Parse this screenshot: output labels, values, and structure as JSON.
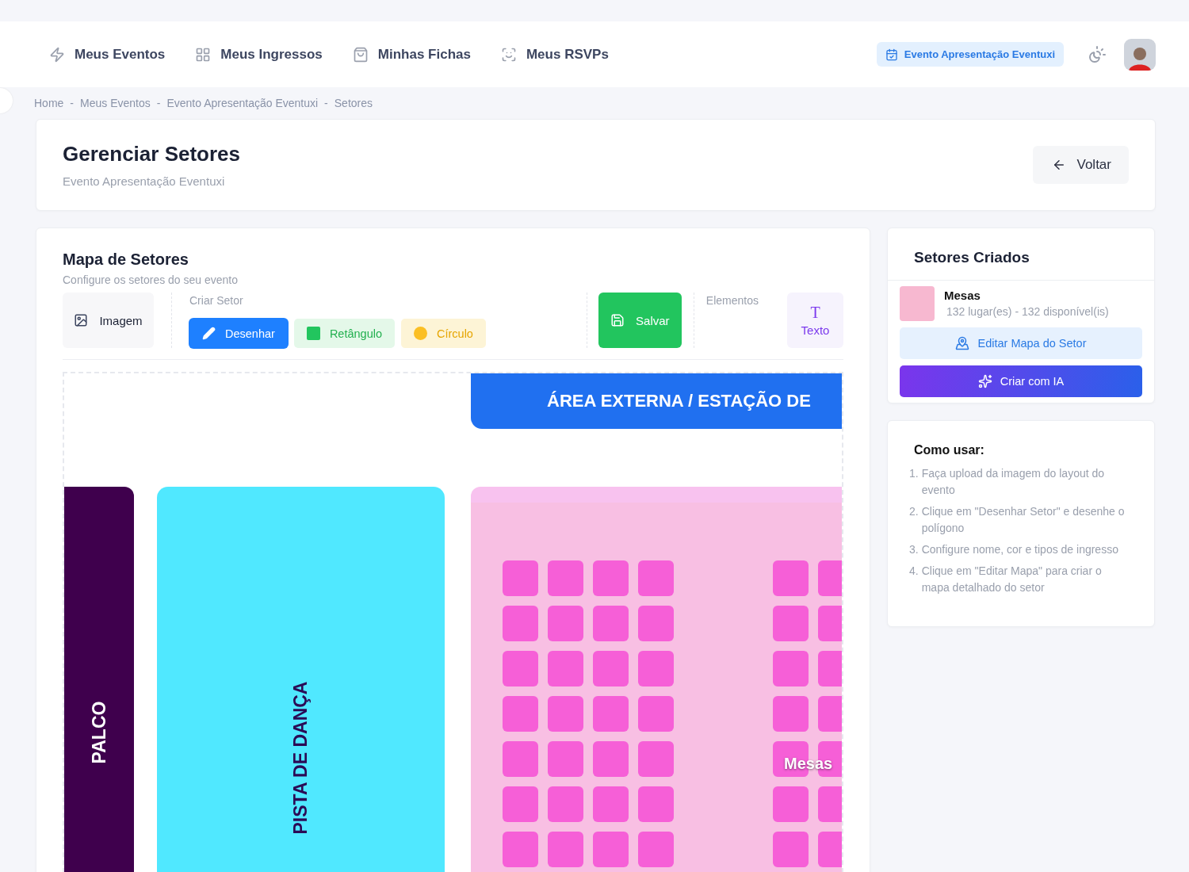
{
  "nav": {
    "items": [
      {
        "label": "Meus Eventos"
      },
      {
        "label": "Meus Ingressos"
      },
      {
        "label": "Minhas Fichas"
      },
      {
        "label": "Meus RSVPs"
      }
    ],
    "event_badge": "Evento Apresentação Eventuxi"
  },
  "breadcrumb": {
    "separator": "-",
    "items": [
      "Home",
      "Meus Eventos",
      "Evento Apresentação Eventuxi",
      "Setores"
    ]
  },
  "page_header": {
    "title": "Gerenciar Setores",
    "subtitle": "Evento Apresentação Eventuxi",
    "back_button": "Voltar"
  },
  "map_panel": {
    "title": "Mapa de Setores",
    "subtitle": "Configure os setores do seu evento",
    "image_button": "Imagem",
    "create_label": "Criar Setor",
    "tools": [
      {
        "kind": "draw",
        "label": "Desenhar",
        "selected": true
      },
      {
        "kind": "rect",
        "label": "Retângulo",
        "selected": false
      },
      {
        "kind": "circle",
        "label": "Círculo",
        "selected": false
      }
    ],
    "save_button": "Salvar",
    "elements_label": "Elementos",
    "elements": [
      {
        "glyph": "T",
        "label": "Texto"
      }
    ],
    "canvas": {
      "banner": "ÁREA EXTERNA / ESTAÇÃO DE",
      "stage": "PALCO",
      "dance_floor": "PISTA DE DANÇA",
      "sector_label": "Mesas"
    }
  },
  "sectors_panel": {
    "title": "Setores Criados",
    "sectors": [
      {
        "name": "Mesas",
        "info": "132 lugar(es) - 132 disponível(is)",
        "color": "#f7b8d0"
      }
    ],
    "edit_button": "Editar Mapa do Setor",
    "ai_button": "Criar com IA"
  },
  "how_to": {
    "title": "Como usar:",
    "steps": [
      {
        "number": "1.",
        "text": "Faça upload da imagem do layout do evento"
      },
      {
        "number": "2.",
        "text": "Clique em \"Desenhar Setor\" e desenhe o polígono"
      },
      {
        "number": "3.",
        "text": "Configure nome, cor e tipos de ingresso"
      },
      {
        "number": "4.",
        "text": "Clique em \"Editar Mapa\" para criar o mapa detalhado do setor"
      }
    ]
  }
}
